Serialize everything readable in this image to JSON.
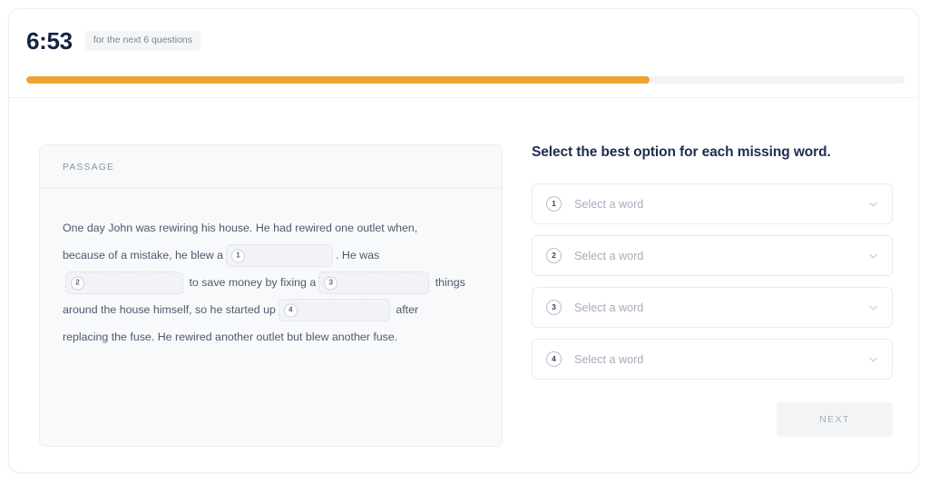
{
  "header": {
    "timer": "6:53",
    "timer_note": "for the next 6 questions",
    "progress_percent": 71,
    "progress_color": "#f0a330"
  },
  "passage": {
    "label": "PASSAGE",
    "segments": {
      "s1": "One day John was rewiring his house. He had rewired one outlet when,",
      "s2": "because of a mistake, he blew a",
      "s3": ". He was",
      "s4": "to save money by fixing a",
      "s5": "things",
      "s6": "around the house himself, so he started up",
      "s7": "after",
      "s8": "replacing the fuse. He rewired another outlet but blew another fuse."
    },
    "blank_numbers": [
      "1",
      "2",
      "3",
      "4"
    ]
  },
  "answers": {
    "title": "Select the best option for each missing word.",
    "placeholder": "Select a word",
    "items": [
      {
        "number": "1",
        "value": "Select a word"
      },
      {
        "number": "2",
        "value": "Select a word"
      },
      {
        "number": "3",
        "value": "Select a word"
      },
      {
        "number": "4",
        "value": "Select a word"
      }
    ],
    "next_label": "NEXT",
    "next_disabled": true
  },
  "icons": {
    "chevron": "chevron-down-icon"
  },
  "colors": {
    "accent": "#f0a330",
    "heading": "#1d2d50",
    "muted": "#a6adba"
  }
}
